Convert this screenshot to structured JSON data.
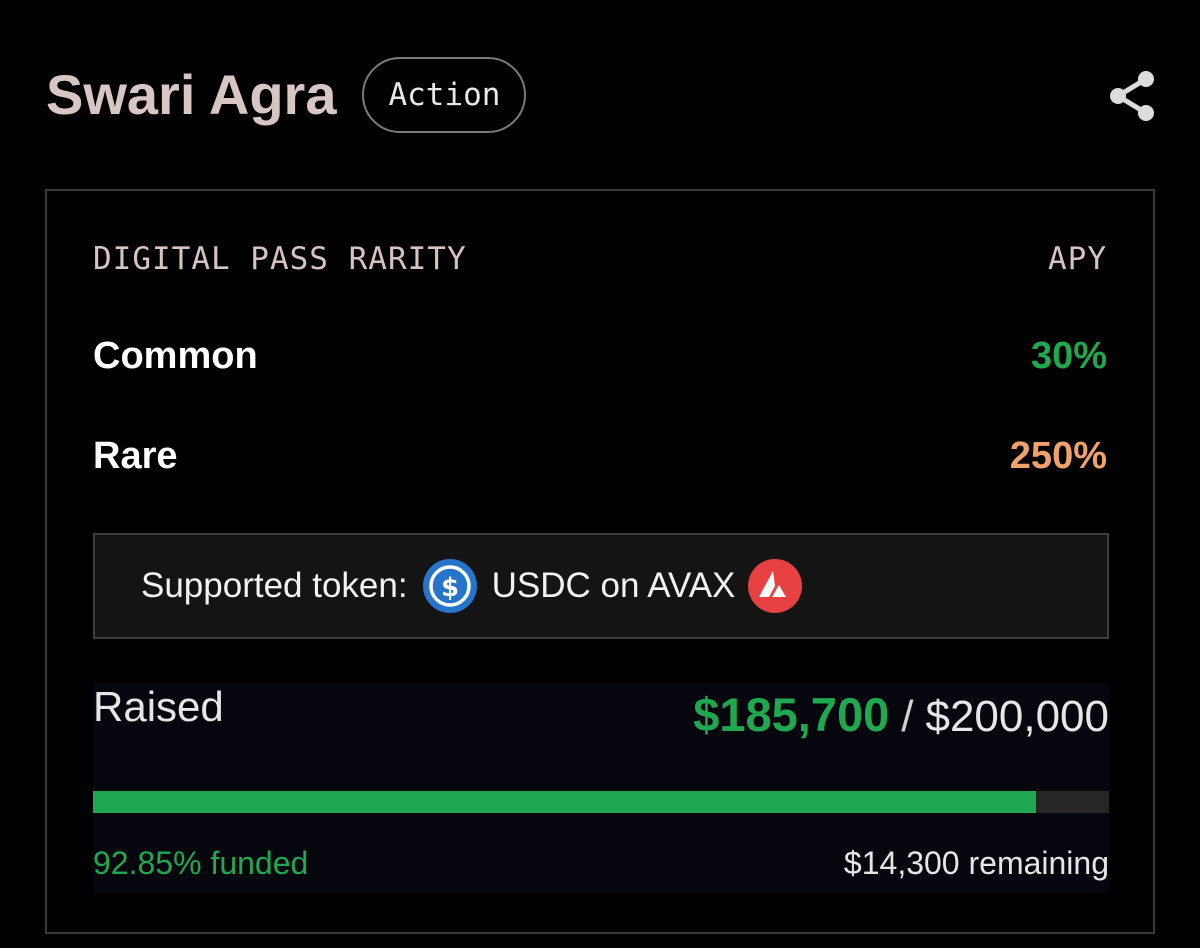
{
  "header": {
    "title": "Swari Agra",
    "badge": "Action",
    "share_icon": "share-icon"
  },
  "card": {
    "column_left": "DIGITAL PASS RARITY",
    "column_right": "APY",
    "tiers": [
      {
        "name": "Common",
        "apy": "30%",
        "color": "#1fa84f"
      },
      {
        "name": "Rare",
        "apy": "250%",
        "color": "#f0a26c"
      }
    ],
    "token": {
      "label": "Supported token:",
      "name": "USDC on AVAX",
      "usdc_icon": "usdc-icon",
      "avax_icon": "avax-icon"
    },
    "raised": {
      "label": "Raised",
      "amount": "$185,700",
      "separator": "/",
      "goal": "$200,000",
      "progress_fraction": 0.9285,
      "funded_text": "92.85% funded",
      "remaining_text": "$14,300 remaining"
    }
  },
  "colors": {
    "accent_green": "#1fa84f",
    "accent_orange": "#f0a26c",
    "usdc_blue": "#2775ca",
    "avax_red": "#e84142"
  }
}
